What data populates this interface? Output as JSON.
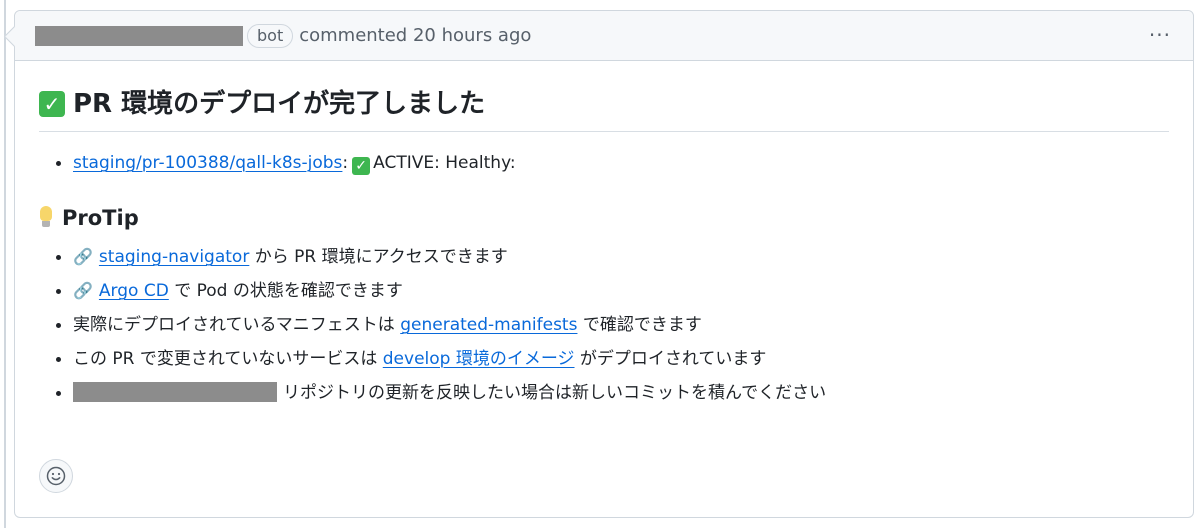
{
  "comment": {
    "header": {
      "badge": "bot",
      "meta_text": "commented 20 hours ago",
      "menu_icon": "kebab-horizontal-icon",
      "menu_label": "···"
    },
    "title": {
      "emoji": "✓",
      "text": "PR 環境のデプロイが完了しました"
    },
    "status_items": [
      {
        "link": "staging/pr-100388/qall-k8s-jobs",
        "colon": ":",
        "check": "✓",
        "status": "ACTIVE: Healthy:"
      }
    ],
    "protip": {
      "icon": "lightbulb-icon",
      "heading": "ProTip",
      "items": [
        {
          "icon": "link-icon",
          "icon_glyph": "🔗",
          "link": "staging-navigator",
          "text_after": " から PR 環境にアクセスできます"
        },
        {
          "icon": "link-icon",
          "icon_glyph": "🔗",
          "link": "Argo CD",
          "text_after": " で Pod の状態を確認できます"
        },
        {
          "text_before": "実際にデプロイされているマニフェストは ",
          "link": "generated-manifests",
          "text_after": " で確認できます"
        },
        {
          "text_before": "この PR で変更されていないサービスは ",
          "link": "develop 環境のイメージ",
          "text_after": " がデプロイされています"
        },
        {
          "text_after": "リポジトリの更新を反映したい場合は新しいコミットを積んでください"
        }
      ]
    },
    "reaction_icon": "smiley-icon",
    "colors": {
      "link": "#0969da",
      "border": "#d0d7de",
      "header_bg": "#f6f8fa",
      "check_green": "#3eb650"
    }
  }
}
